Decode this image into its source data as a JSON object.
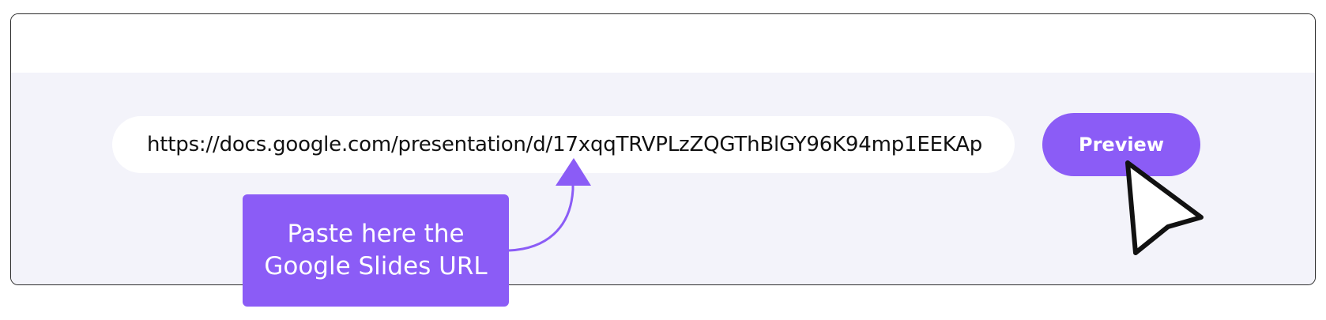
{
  "url_field": {
    "value": "https://docs.google.com/presentation/d/17xqqTRVPLzZQGThBlGY96K94mp1EEKAp"
  },
  "preview_button": {
    "label": "Preview"
  },
  "callout": {
    "line1": "Paste here the",
    "line2": "Google Slides URL"
  },
  "icons": {
    "arrow": "curved-arrow-icon",
    "cursor": "mouse-pointer-icon"
  },
  "colors": {
    "accent": "#8b5cf6",
    "panel_background": "#f3f3fa",
    "border": "#2b2b2b"
  }
}
